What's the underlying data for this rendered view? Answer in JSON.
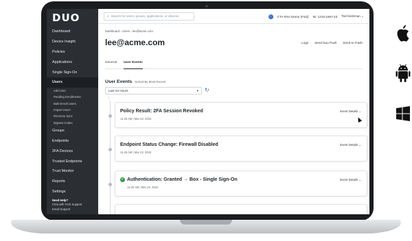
{
  "app": {
    "logo_text": "DUO"
  },
  "sidebar": {
    "items": [
      {
        "label": "Dashboard"
      },
      {
        "label": "Device Insight"
      },
      {
        "label": "Policies"
      },
      {
        "label": "Applications"
      },
      {
        "label": "Single Sign-On"
      },
      {
        "label": "Users"
      }
    ],
    "user_subitems": [
      {
        "label": "Add User"
      },
      {
        "label": "Pending Enrollments"
      },
      {
        "label": "Bulk Enroll Users"
      },
      {
        "label": "Import Users"
      },
      {
        "label": "Directory Sync"
      },
      {
        "label": "Bypass Codes"
      }
    ],
    "items_after": [
      {
        "label": "Groups"
      },
      {
        "label": "Endpoints"
      },
      {
        "label": "2FA Devices"
      },
      {
        "label": "Trusted Endpoints"
      },
      {
        "label": "Trust Monitor"
      },
      {
        "label": "Reports"
      },
      {
        "label": "Settings"
      }
    ],
    "help": {
      "title": "Need Help?",
      "chat": "Chat with Tech Support",
      "email": "Email Support"
    }
  },
  "topbar": {
    "search_placeholder": "Search for users, groups, applications, or devices",
    "account_name": "CTA RSA Demo (Find)",
    "account_id": "ID: 1216-1667-43",
    "user_name": "Ted Kielzman"
  },
  "breadcrumb": {
    "items": [
      "Dashboard",
      "Users",
      "lee@acme.com"
    ]
  },
  "page": {
    "title": "lee@acme.com",
    "actions": [
      "Logs",
      "Send Duo Push",
      "Send to Trash"
    ],
    "tabs": [
      {
        "label": "General"
      },
      {
        "label": "User Events"
      }
    ]
  },
  "events_section": {
    "heading": "User Events",
    "sort_note": "Sorted By Most Recent",
    "range_select": "Last 24 Hours"
  },
  "events": [
    {
      "title": "Policy Result: 2FA Session Revoked",
      "time": "11:25 AM | Mar 22, 2022",
      "link": "Event Details"
    },
    {
      "title": "Endpoint Status Change: Firewall Disabled",
      "time": "11:25 AM | Mar 22, 2022",
      "link": "Event Details"
    },
    {
      "title": "Authentication: Granted → Box - Single Sign-On",
      "time": "11:25 AM | Mar 22, 2022",
      "link": "Event Details"
    }
  ],
  "colors": {
    "sidebar_bg": "#2b2e33",
    "success_green": "#2e9b48",
    "link_blue": "#2b6cd6"
  },
  "icons": [
    "search-icon",
    "globe-icon",
    "chevron-down-icon",
    "refresh-icon",
    "check-circle-icon",
    "apple-icon",
    "android-icon",
    "windows-icon"
  ]
}
